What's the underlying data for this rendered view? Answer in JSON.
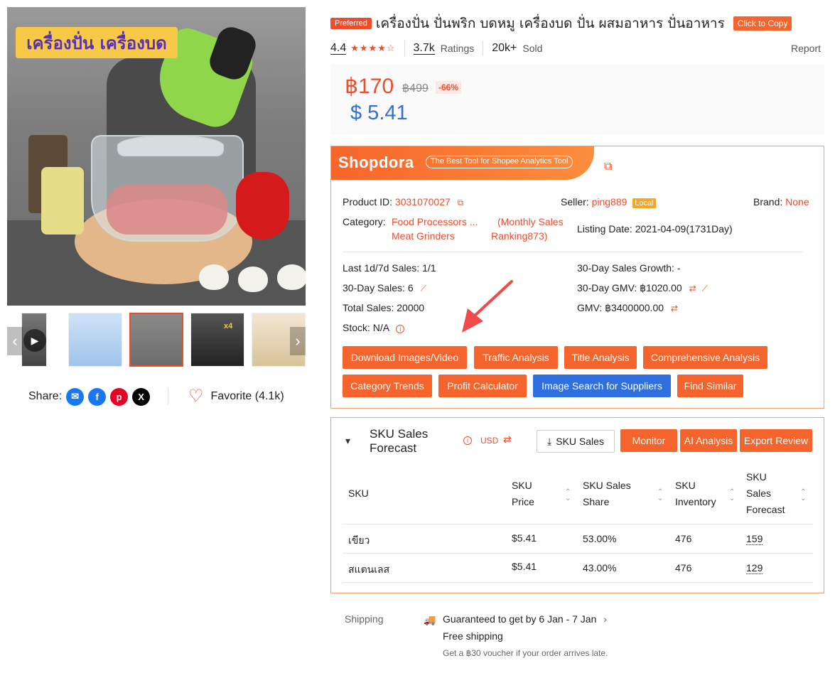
{
  "gallery": {
    "banner_text": "เครื่องปั่น เครื่องบด",
    "thumb_nav_prev": "‹",
    "thumb_nav_next": "›",
    "thumb_badge": "x4"
  },
  "share": {
    "label": "Share:"
  },
  "favorite": {
    "label": "Favorite (4.1k)"
  },
  "product": {
    "preferred_badge": "Preferred",
    "title": "เครื่องปั่น ปั่นพริก บดหมู เครื่องบด ปั่น ผสมอาหาร ปั่นอาหาร",
    "copy_button": "Click to Copy",
    "rating": "4.4",
    "stars": "★★★★☆",
    "ratings_count": "3.7k",
    "ratings_label": "Ratings",
    "sold_count": "20k+",
    "sold_label": "Sold",
    "report": "Report",
    "price": "฿170",
    "original_price": "฿499",
    "discount": "-66%",
    "price_usd": "$ 5.41"
  },
  "shopdora": {
    "logo": "Shopdora",
    "tagline": "The Best Tool for Shopee Analytics Tool",
    "product_id_label": "Product ID:",
    "product_id": "3031070027",
    "seller_label": "Seller:",
    "seller": "ping889",
    "seller_badge": "Local",
    "brand_label": "Brand:",
    "brand": "None",
    "category_label": "Category:",
    "category_line1": "Food Processors ...",
    "category_line2": "Meat Grinders",
    "ranking_line1": "(Monthly Sales",
    "ranking_line2": "Ranking873)",
    "listing_date_label": "Listing Date:",
    "listing_date": "2021-04-09(1731Day)",
    "last_sales": "Last 1d/7d Sales: 1/1",
    "growth": "30-Day Sales Growth: -",
    "sales_30": "30-Day Sales: 6",
    "gmv_30": "30-Day GMV: ฿1020.00",
    "total_sales": "Total Sales: 20000",
    "gmv": "GMV: ฿3400000.00",
    "stock": "Stock: N/A",
    "buttons": {
      "download": "Download Images/Video",
      "traffic": "Traffic Analysis",
      "title": "Title Analysis",
      "comprehensive": "Comprehensive Analysis",
      "category_trends": "Category Trends",
      "profit": "Profit Calculator",
      "image_search": "Image Search for Suppliers",
      "find_similar": "Find Similar"
    }
  },
  "sku": {
    "title": "SKU Sales Forecast",
    "currency": "USD",
    "sales_button": "SKU Sales",
    "monitor_button": "Monitor",
    "ai_button": "AI Analysis",
    "export_button": "Export Review",
    "headers": {
      "sku": "SKU",
      "price_l1": "SKU",
      "price_l2": "Price",
      "share_l1": "SKU Sales",
      "share_l2": "Share",
      "inv_l1": "SKU",
      "inv_l2": "Inventory",
      "fc_l1": "SKU",
      "fc_l2": "Sales",
      "fc_l3": "Forecast"
    },
    "rows": [
      {
        "sku": "เขียว",
        "price": "$5.41",
        "share": "53.00%",
        "inventory": "476",
        "forecast": "159"
      },
      {
        "sku": "สแตนเลส",
        "price": "$5.41",
        "share": "43.00%",
        "inventory": "476",
        "forecast": "129"
      }
    ]
  },
  "shipping": {
    "label": "Shipping",
    "guarantee": "Guaranteed to get by 6 Jan - 7 Jan",
    "free": "Free shipping",
    "voucher": "Get a ฿30 voucher if your order arrives late."
  },
  "colors": {
    "accent": "#ee4d2d",
    "blue": "#2f6fe0",
    "green": "#26aa99"
  }
}
